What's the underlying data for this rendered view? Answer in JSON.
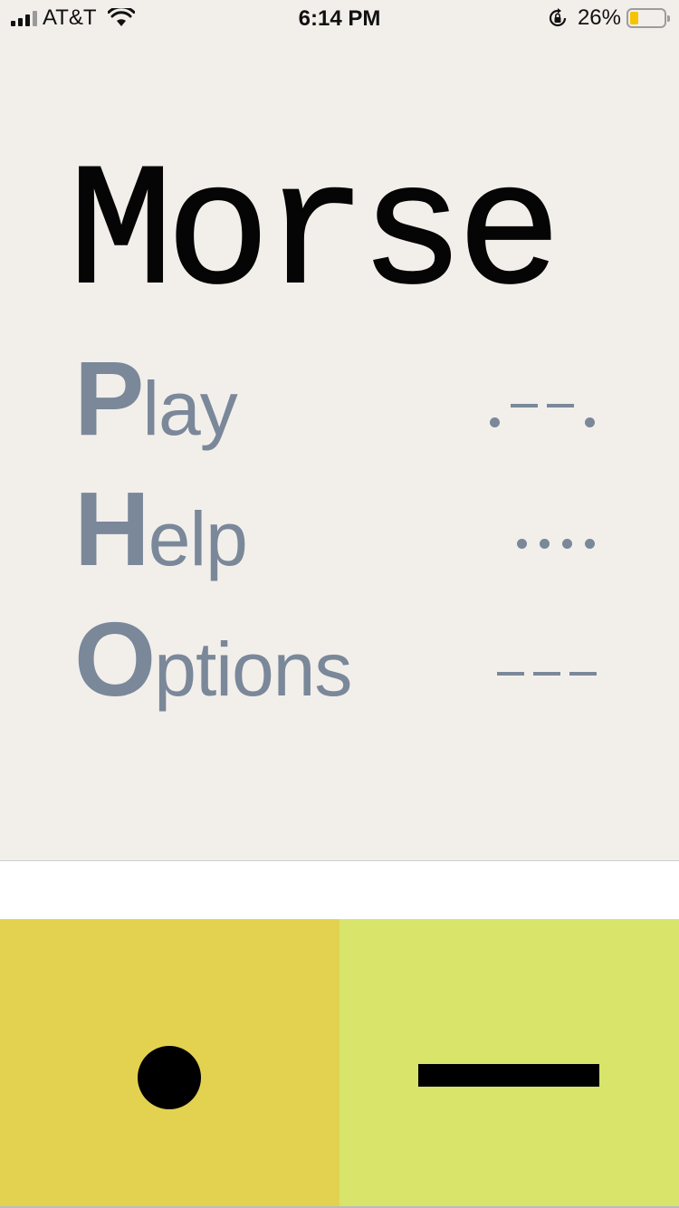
{
  "status_bar": {
    "carrier": "AT&T",
    "time": "6:14 PM",
    "battery_percent": "26%",
    "battery_level": 0.26,
    "icons": [
      "signal-bars-icon",
      "wifi-icon",
      "rotation-lock-icon",
      "battery-icon"
    ]
  },
  "app": {
    "title": "Morse"
  },
  "menu": [
    {
      "initial": "P",
      "rest": "lay",
      "code": ".--."
    },
    {
      "initial": "H",
      "rest": "elp",
      "code": "...."
    },
    {
      "initial": "O",
      "rest": "ptions",
      "code": "---"
    }
  ],
  "input": {
    "value": ""
  },
  "keys": {
    "dot_icon": "dot-icon",
    "dash_icon": "dash-icon"
  },
  "colors": {
    "background": "#f2efeb",
    "title": "#050505",
    "menu_text": "#7a8899",
    "dot_key": "#e3d24f",
    "dash_key": "#d8e46a",
    "battery_fill": "#f5c400"
  }
}
